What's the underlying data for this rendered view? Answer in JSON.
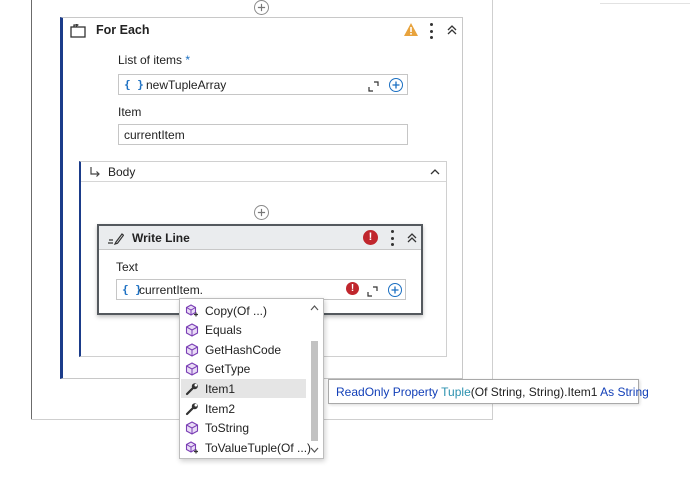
{
  "for_each": {
    "title": "For Each",
    "list_label": "List of items",
    "required_marker": "*",
    "list_value": "newTupleArray",
    "item_label": "Item",
    "item_value": "currentItem"
  },
  "body": {
    "title": "Body"
  },
  "write_line": {
    "title": "Write Line",
    "text_label": "Text",
    "text_value": "currentItem.",
    "error_glyph": "!"
  },
  "expression_glyph": "{ }",
  "autocomplete": {
    "items": [
      {
        "label": "Copy(Of ...)",
        "icon": "extension-method-icon"
      },
      {
        "label": "Equals",
        "icon": "method-icon"
      },
      {
        "label": "GetHashCode",
        "icon": "method-icon"
      },
      {
        "label": "GetType",
        "icon": "method-icon"
      },
      {
        "label": "Item1",
        "icon": "property-wrench-icon",
        "selected": true
      },
      {
        "label": "Item2",
        "icon": "property-wrench-icon"
      },
      {
        "label": "ToString",
        "icon": "method-icon"
      },
      {
        "label": "ToValueTuple(Of ...)",
        "icon": "extension-method-icon"
      }
    ]
  },
  "tooltip": {
    "kw1": "ReadOnly Property ",
    "type1": "Tuple",
    "plain1": "(Of String, String).Item1 ",
    "kw2": "As String"
  },
  "colors": {
    "accent_blue": "#1b6fc2",
    "activity_border": "#1b3c8a",
    "warning": "#e8a33d",
    "error": "#c0262d",
    "method_purple": "#7b3fb5"
  }
}
